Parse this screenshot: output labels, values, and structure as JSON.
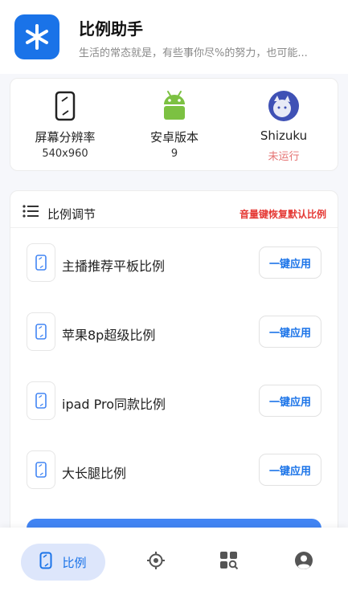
{
  "app": {
    "title": "比例助手",
    "subtitle": "生活的常态就是，有些事你尽%的努力，也可能..."
  },
  "info": [
    {
      "icon": "phone-icon",
      "label": "屏幕分辨率",
      "value": "540x960"
    },
    {
      "icon": "android-icon",
      "label": "安卓版本",
      "value": "9"
    },
    {
      "icon": "shizuku-icon",
      "label": "Shizuku",
      "value": "未运行"
    }
  ],
  "ratio_section": {
    "title": "比例调节",
    "hint": "音量键恢复默认比例",
    "items": [
      {
        "label": "主播推荐平板比例",
        "button": "一键应用"
      },
      {
        "label": "苹果8p超级比例",
        "button": "一键应用"
      },
      {
        "label": "ipad Pro同款比例",
        "button": "一键应用"
      },
      {
        "label": "大长腿比例",
        "button": "一键应用"
      }
    ]
  },
  "nav": {
    "active_label": "比例",
    "items": [
      "ratio-icon",
      "locate-icon",
      "apps-search-icon",
      "account-icon"
    ]
  },
  "colors": {
    "accent": "#1a73e8",
    "warning": "#e53935",
    "android": "#7cc142"
  }
}
